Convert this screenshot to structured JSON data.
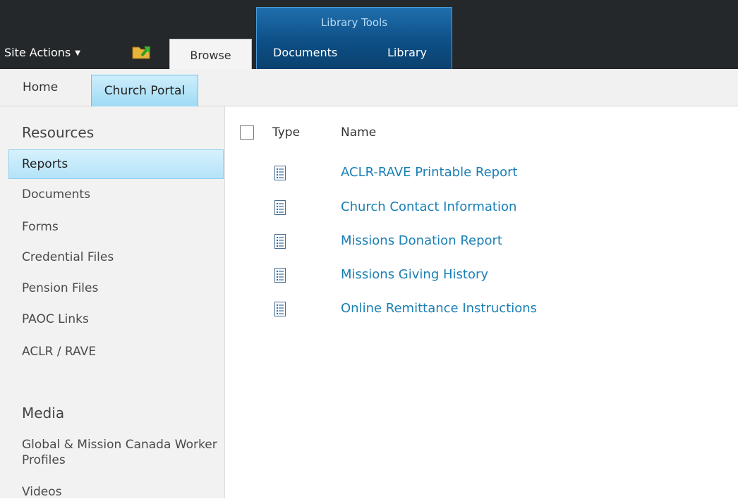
{
  "ribbon": {
    "site_actions": "Site Actions",
    "browse_tab": "Browse",
    "context_group": "Library Tools",
    "documents_tab": "Documents",
    "library_tab": "Library"
  },
  "topnav": {
    "home": "Home",
    "church_portal": "Church Portal"
  },
  "leftnav": {
    "resources_heading": "Resources",
    "resources": [
      "Reports",
      "Documents",
      "Forms",
      "Credential Files",
      "Pension Files",
      "PAOC Links",
      "ACLR / RAVE"
    ],
    "media_heading": "Media",
    "media": [
      "Global & Mission Canada Worker Profiles",
      "Videos"
    ]
  },
  "list": {
    "col_type": "Type",
    "col_name": "Name",
    "rows": [
      "ACLR-RAVE Printable Report",
      "Church Contact Information",
      "Missions Donation Report",
      "Missions Giving History",
      "Online Remittance Instructions"
    ]
  },
  "colors": {
    "ribbon_bg": "#24282b",
    "context_blue": "#0d4f86",
    "link": "#1a7fb5",
    "selected_bg": "#b4e3f8"
  }
}
